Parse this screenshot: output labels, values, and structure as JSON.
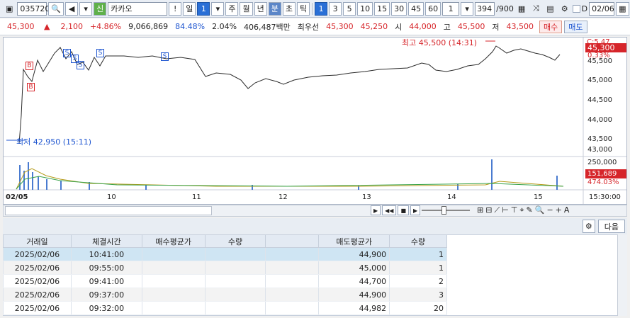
{
  "toolbar": {
    "stock_code": "035720",
    "stock_name": "카카오",
    "period_buttons": [
      "일",
      "1",
      "주",
      "월",
      "년",
      "분",
      "초",
      "틱"
    ],
    "interval_buttons": [
      "1",
      "3",
      "5",
      "10",
      "15",
      "30",
      "45",
      "60"
    ],
    "count_value": "1",
    "page_text": "394",
    "page_total": "/900",
    "d_label": "D",
    "date_value": "02/06"
  },
  "quote": {
    "price": "45,300",
    "change_arrow": "▲",
    "change": "2,100",
    "change_pct": "+4.86%",
    "volume": "9,066,869",
    "turnover_pct": "84.48%",
    "ratio": "2.04%",
    "amount": "406,487백만",
    "best_label": "최우선",
    "bid": "45,300",
    "ask": "45,250",
    "open_label": "시",
    "open": "44,000",
    "high_label": "고",
    "high": "45,500",
    "low_label": "저",
    "low": "43,500",
    "buy_label": "매수",
    "sell_label": "매도"
  },
  "chart": {
    "high_note": "최고 45,500 (14:31)",
    "low_note": "최저 42,950 (15:11)",
    "current_label": "45,300",
    "pct_label": "0.33%",
    "y_ticks": [
      "45,500",
      "45,000",
      "44,500",
      "44,000",
      "43,500",
      "43,000"
    ],
    "vol_ticks": [
      "250,000",
      "151,689",
      "474.03%"
    ],
    "x_ticks": [
      "02/05",
      "10",
      "11",
      "12",
      "13",
      "14",
      "15",
      "15:30:00"
    ],
    "signals": [
      "B",
      "B",
      "S",
      "S",
      "S",
      "S",
      "S"
    ],
    "c_label": "C:5.47"
  },
  "grid_tool": {
    "next_label": "다음"
  },
  "table": {
    "headers": [
      "거래일",
      "체결시간",
      "매수평균가",
      "수량",
      "",
      "매도평균가",
      "수량"
    ],
    "rows": [
      [
        "2025/02/06",
        "10:41:00",
        "",
        "",
        "",
        "44,900",
        "1"
      ],
      [
        "2025/02/06",
        "09:55:00",
        "",
        "",
        "",
        "45,000",
        "1"
      ],
      [
        "2025/02/06",
        "09:41:00",
        "",
        "",
        "",
        "44,700",
        "2"
      ],
      [
        "2025/02/06",
        "09:37:00",
        "",
        "",
        "",
        "44,900",
        "3"
      ],
      [
        "2025/02/06",
        "09:32:00",
        "",
        "",
        "",
        "44,982",
        "20"
      ]
    ]
  },
  "colors": {
    "up": "#d6252a",
    "down": "#1f56d0",
    "selected_row": "#cfe5f3"
  }
}
